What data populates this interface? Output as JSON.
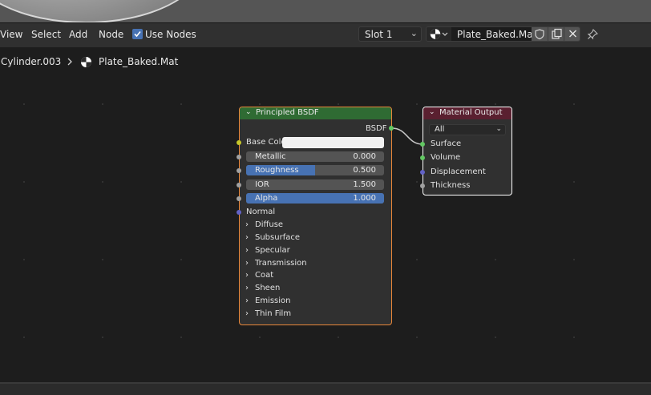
{
  "header": {
    "menus": [
      "View",
      "Select",
      "Add",
      "Node"
    ],
    "use_nodes_label": "Use Nodes",
    "use_nodes_checked": true,
    "slot_label": "Slot 1",
    "material_name": "Plate_Baked.Mat"
  },
  "breadcrumb": {
    "object": "Cylinder.003",
    "material": "Plate_Baked.Mat"
  },
  "nodes": {
    "bsdf": {
      "title": "Principled BSDF",
      "output": "BSDF",
      "base_color_label": "Base Color",
      "base_color": "#f2f2f2",
      "fields": [
        {
          "name": "Metallic",
          "value": "0.000",
          "fraction": 0.0
        },
        {
          "name": "Roughness",
          "value": "0.500",
          "fraction": 0.5
        },
        {
          "name": "IOR",
          "value": "1.500",
          "fraction": 0.0
        },
        {
          "name": "Alpha",
          "value": "1.000",
          "fraction": 1.0
        }
      ],
      "normal_label": "Normal",
      "panels": [
        "Diffuse",
        "Subsurface",
        "Specular",
        "Transmission",
        "Coat",
        "Sheen",
        "Emission",
        "Thin Film"
      ]
    },
    "output": {
      "title": "Material Output",
      "target": "All",
      "inputs": [
        "Surface",
        "Volume",
        "Displacement",
        "Thickness"
      ]
    }
  },
  "colors": {
    "accent": "#4772b3",
    "bsdf_header": "#2f6b33",
    "output_header": "#5a2030",
    "selected_outline": "#e8873a",
    "socket_color": "#c7c729",
    "socket_float": "#a1a1a1",
    "socket_vector": "#6363c7",
    "socket_shader": "#63c763"
  }
}
